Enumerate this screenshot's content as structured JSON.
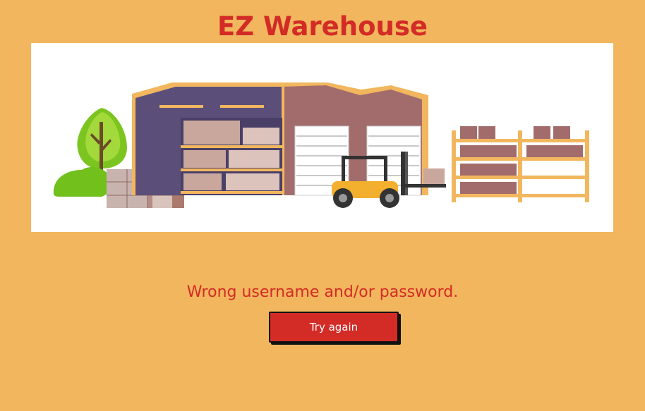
{
  "app": {
    "title": "EZ Warehouse"
  },
  "banner": {
    "illustration": "warehouse-illustration"
  },
  "message": {
    "error_text": "Wrong username and/or password."
  },
  "actions": {
    "retry_label": "Try again"
  },
  "colors": {
    "background": "#f2b75e",
    "accent": "#d32b26",
    "panel": "#ffffff"
  }
}
